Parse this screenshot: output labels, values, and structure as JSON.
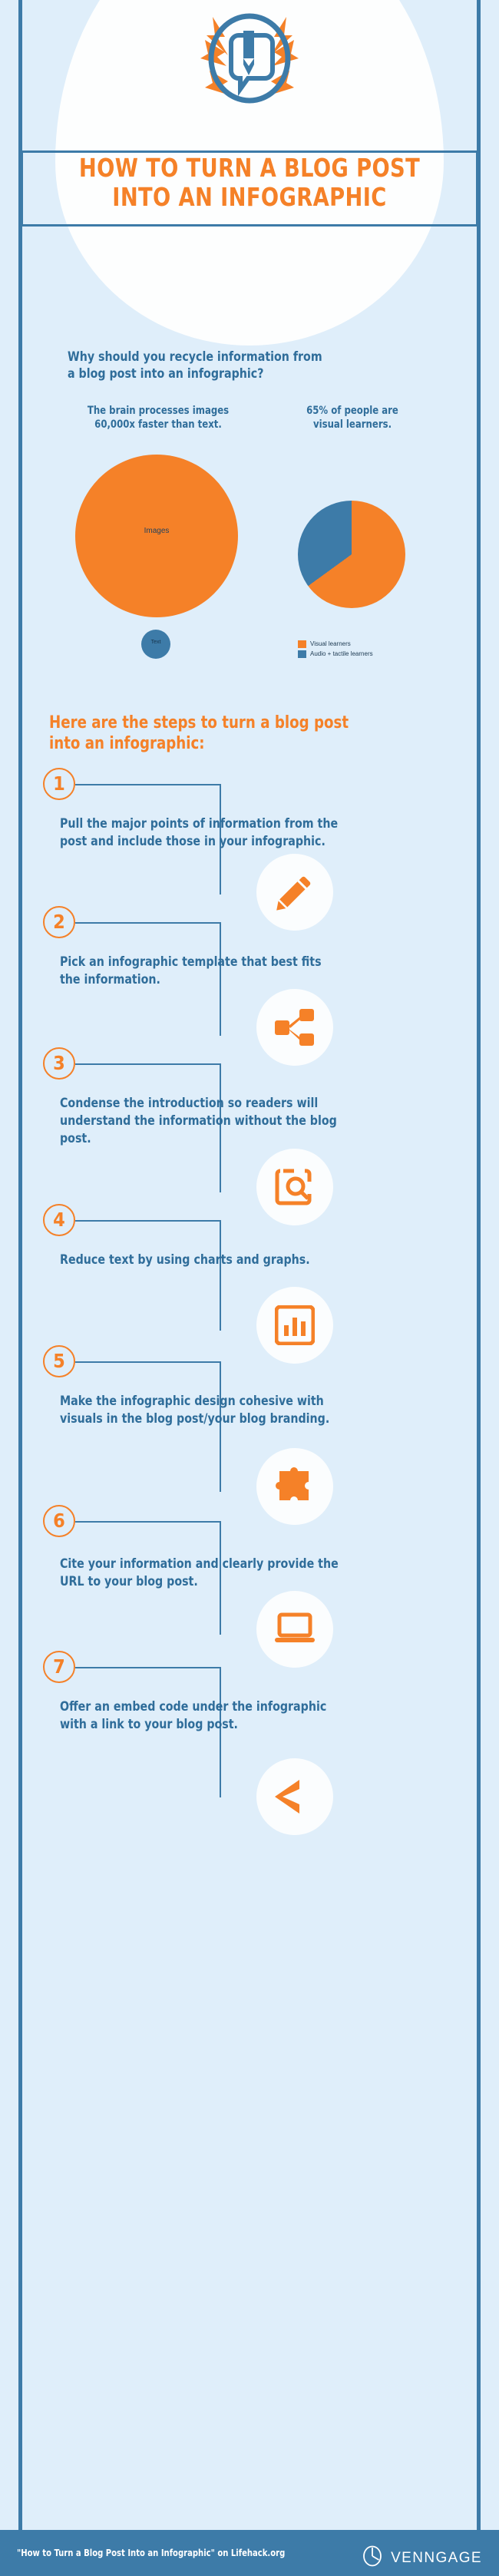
{
  "colors": {
    "background": "#dfeefa",
    "orange": "#f58128",
    "blue": "#3d7ba8",
    "dark_blue": "#24425c",
    "white": "#fdfefe"
  },
  "header": {
    "hero_icon": "blog-post-pencil-speech-bubble-icon",
    "title_line_1": "HOW TO TURN A BLOG POST",
    "title_line_2": "INTO AN INFOGRAPHIC"
  },
  "why_section": {
    "heading_line_1": "Why should you recycle information from",
    "heading_line_2": "a blog post into an infographic?",
    "stat_left_line_1": "The brain processes images",
    "stat_left_line_2": "60,000x faster than text.",
    "stat_right_line_1": "65% of people are",
    "stat_right_line_2": "visual learners."
  },
  "chart_data": [
    {
      "type": "bubble",
      "title": "The brain processes images 60,000x faster than text.",
      "categories": [
        "Images",
        "Text"
      ],
      "values": [
        60000,
        1
      ],
      "labels": [
        "Images",
        "Text"
      ],
      "colors": [
        "#f58128",
        "#3d7ba8"
      ],
      "note": "Two proportional circles: large orange 'Images' circle vs tiny blue 'Text' circle, ratio 60,000x",
      "legend": false
    },
    {
      "type": "pie",
      "title": "65% of people are visual learners.",
      "categories": [
        "Visual learners",
        "Audio + tactile learners"
      ],
      "values": [
        65,
        35
      ],
      "colors": [
        "#f58128",
        "#3d7ba8"
      ],
      "legend": true,
      "legend_position": "bottom-left",
      "legend_entries": [
        "Visual learners",
        "Audio + tactile learners"
      ]
    }
  ],
  "steps_section": {
    "heading_line_1": "Here are the steps to turn a blog post",
    "heading_line_2": "into an infographic:",
    "steps": [
      {
        "number": "1",
        "text": "Pull the major points of information from the post and include those in your infographic.",
        "icon": "pencil-icon"
      },
      {
        "number": "2",
        "text": "Pick an infographic template that best fits the information.",
        "icon": "share-nodes-icon"
      },
      {
        "number": "3",
        "text": "Condense the introduction so readers will understand the information without the blog post.",
        "icon": "document-search-icon"
      },
      {
        "number": "4",
        "text": "Reduce text by using charts and graphs.",
        "icon": "bar-chart-icon"
      },
      {
        "number": "5",
        "text": "Make the infographic design cohesive with visuals in the blog post/your blog branding.",
        "icon": "puzzle-piece-icon"
      },
      {
        "number": "6",
        "text": "Cite your information and clearly provide the URL to your blog post.",
        "icon": "laptop-icon"
      },
      {
        "number": "7",
        "text": "Offer an embed code under the infographic with a link to your blog post.",
        "icon": "embed-code-icon"
      }
    ]
  },
  "footer": {
    "source": "\"How to Turn a Blog Post Into an Infographic\" on Lifehack.org",
    "brand": "VENNGAGE",
    "brand_icon": "venngage-logo-icon"
  }
}
